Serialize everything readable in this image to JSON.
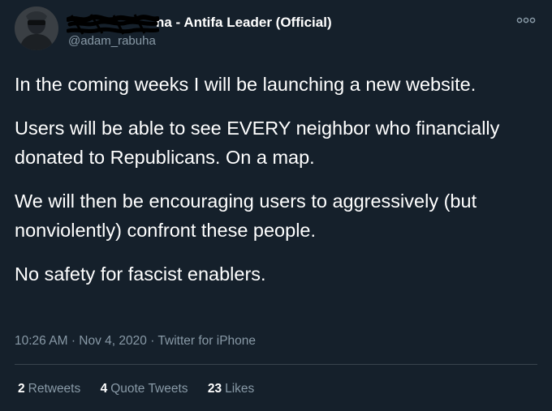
{
  "tweet": {
    "display_name_visible": "ha - Antifa Leader (Official)",
    "handle": "@adam_rabuha",
    "paragraphs": [
      "In the coming weeks I will be launching a new website.",
      "Users will be able to see EVERY neighbor who financially donated to Republicans. On a map.",
      "We will then be encouraging users to aggressively (but nonviolently) confront these people.",
      "No safety for fascist enablers."
    ],
    "time": "10:26 AM",
    "date": "Nov 4, 2020",
    "source": "Twitter for iPhone",
    "separator": "·",
    "stats": {
      "retweets_count": "2",
      "retweets_label": "Retweets",
      "quote_count": "4",
      "quote_label": "Quote Tweets",
      "likes_count": "23",
      "likes_label": "Likes"
    }
  },
  "icons": {
    "more": "more-icon",
    "avatar": "avatar-image"
  },
  "colors": {
    "background": "#15202b",
    "text_primary": "#ffffff",
    "text_secondary": "#8899a6",
    "divider": "#38444d"
  }
}
